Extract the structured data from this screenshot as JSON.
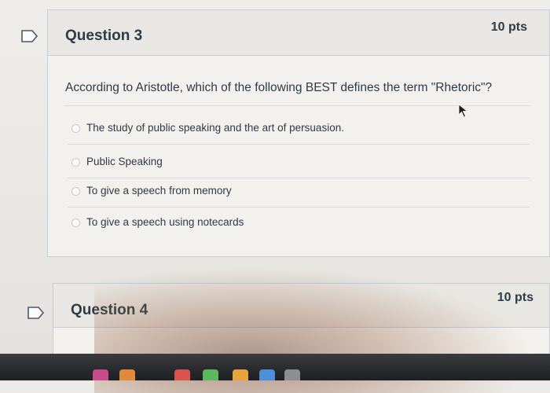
{
  "question3": {
    "title": "Question 3",
    "points": "10 pts",
    "text": "According to Aristotle, which of the following BEST defines the term \"Rhetoric\"?",
    "answers": [
      {
        "label": "The study of public speaking and the art of persuasion."
      },
      {
        "label": "Public Speaking"
      },
      {
        "label": "To give a speech from memory"
      },
      {
        "label": "To give a speech using notecards"
      }
    ]
  },
  "question4": {
    "title": "Question 4",
    "points": "10 pts"
  },
  "icons": {
    "flag": "bookmark-flag-icon",
    "cursor": "mouse-pointer-icon"
  },
  "colors": {
    "text": "#2d3b45",
    "border": "#c7cdd1",
    "background": "#efedea"
  }
}
